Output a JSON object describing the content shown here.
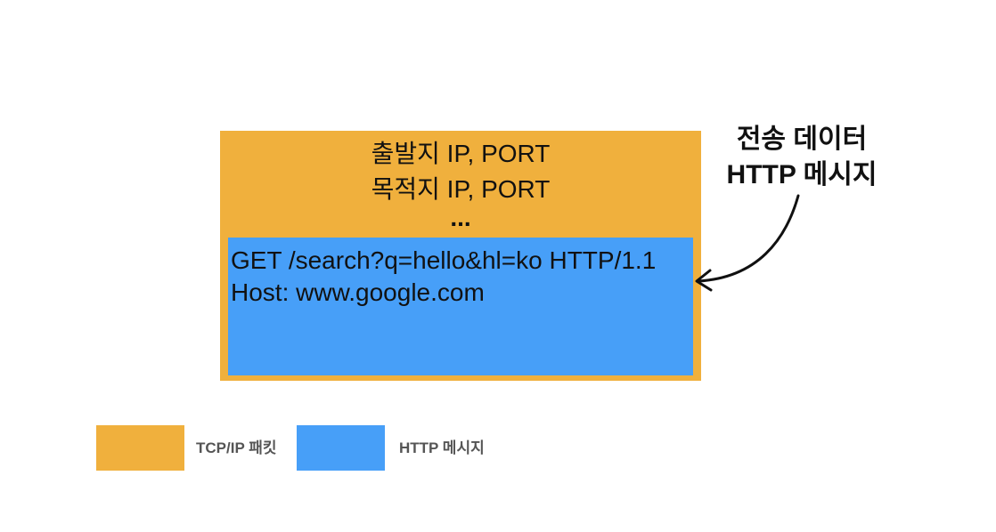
{
  "packet": {
    "color": "#F0B03D",
    "header_lines": [
      "출발지 IP, PORT",
      "목적지 IP, PORT",
      "..."
    ]
  },
  "http_message": {
    "color": "#479FF8",
    "lines": [
      "GET /search?q=hello&hl=ko HTTP/1.1",
      "Host: www.google.com"
    ]
  },
  "annotation": {
    "lines": [
      "전송 데이터",
      "HTTP 메시지"
    ],
    "arrow_icon": "curved-arrow-left"
  },
  "legend": [
    {
      "label": "TCP/IP 패킷",
      "color": "#F0B03D"
    },
    {
      "label": "HTTP 메시지",
      "color": "#479FF8"
    }
  ]
}
